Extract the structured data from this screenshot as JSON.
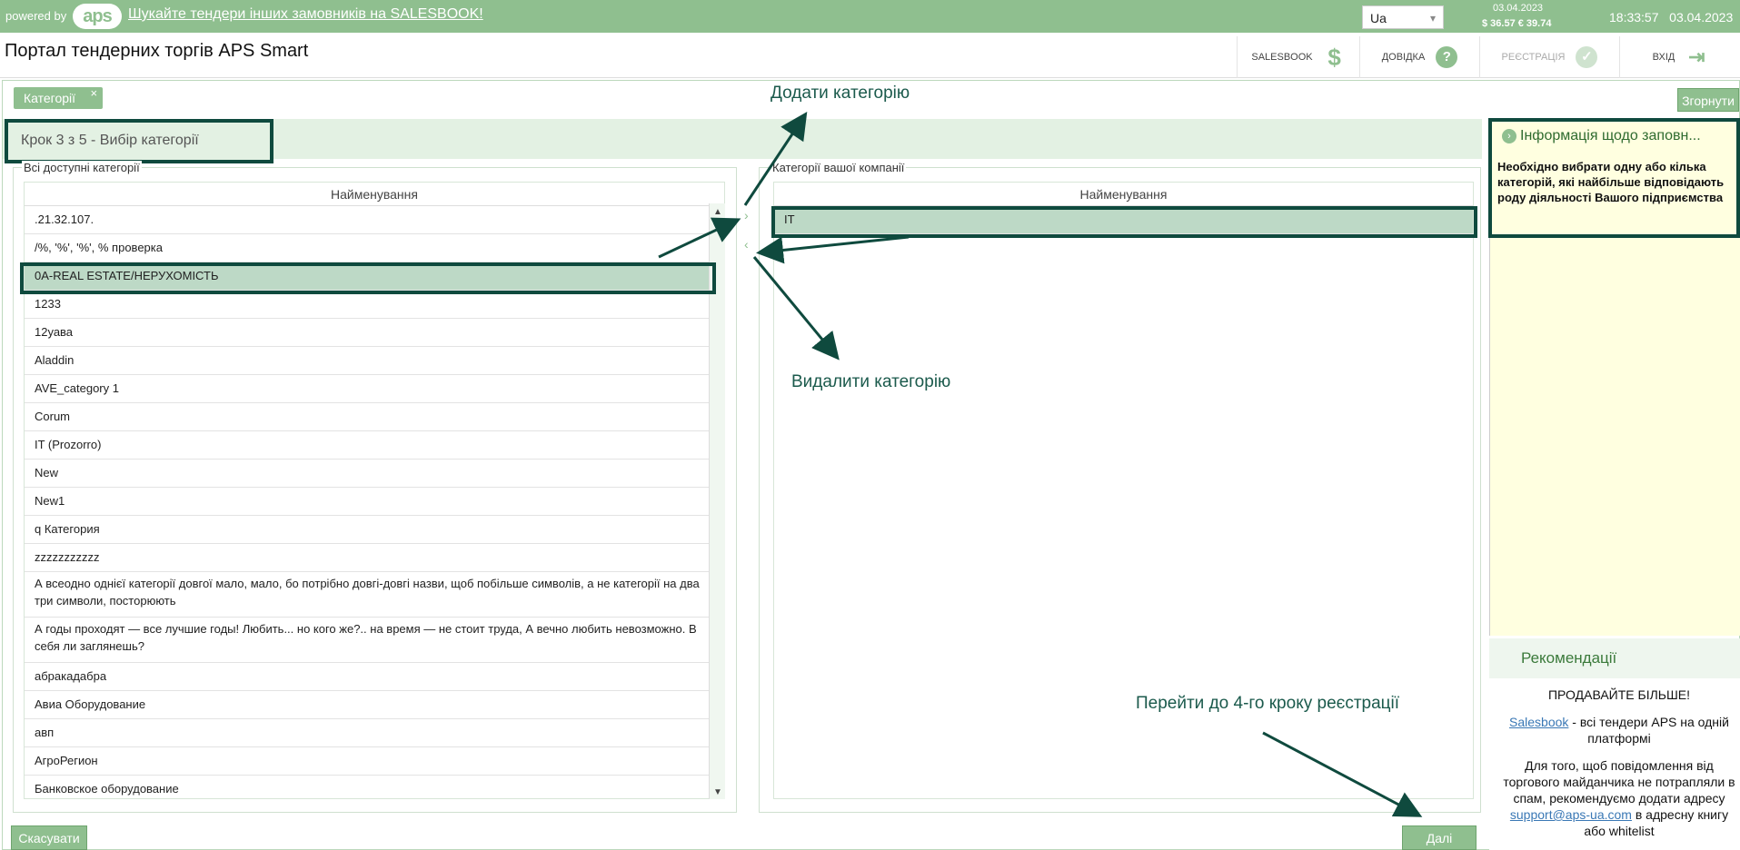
{
  "topbar": {
    "powered_by": "powered by",
    "logo_text": "aps",
    "promo_link": "Шукайте тендери інших замовників на SALESBOOK!",
    "language": "Ua",
    "rates_date": "03.04.2023",
    "rates": "$ 36.57  € 39.74",
    "time": "18:33:57",
    "date": "03.04.2023"
  },
  "header": {
    "title": "Портал тендерних торгів APS Smart",
    "nav": {
      "salesbook": "SALESBOOK",
      "help": "ДОВІДКА",
      "registration": "РЕЄСТРАЦІЯ",
      "login": "ВХІД"
    }
  },
  "tabs": {
    "categories": "Категорії",
    "close": "×",
    "collapse": "Згорнути"
  },
  "step": {
    "title": "Крок 3 з 5 - Вибір категорії"
  },
  "available": {
    "legend": "Всі доступні категорії",
    "column": "Найменування",
    "rows": [
      ".21.32.107.",
      "/%, '%', '%', % проверка",
      "0A-REAL ESTATE/НЕРУХОМІСТЬ",
      "1233",
      "12уава",
      "Aladdin",
      "AVE_category 1",
      "Corum",
      "IT (Prozorro)",
      "New",
      "New1",
      "q Категория",
      "zzzzzzzzzzz",
      "А всеодно однієї категорії довгої мало, мало, бо потрібно довгі-довгі назви, щоб побільше символів, а не категорії на два три символи, посторюють",
      "А годы проходят — все лучшие годы! Любить... но кого же?.. на время — не стоит труда, А вечно любить невозможно. В себя ли заглянешь?",
      "абракадабра",
      "Авиа Оборудование",
      "авп",
      "АгроРегион",
      "Банковское оборудование"
    ],
    "selected_index": 2
  },
  "company": {
    "legend": "Категорії вашої компанії",
    "column": "Найменування",
    "rows": [
      "IT"
    ]
  },
  "annotations": {
    "add": "Додати категорію",
    "remove": "Видалити категорію",
    "next_step": "Перейти до 4-го кроку реєстрації"
  },
  "info": {
    "title": "Інформація щодо заповн...",
    "text": "Необхідно вибрати одну або кілька категорій, які найбільше відповідають роду діяльності Вашого підприємства"
  },
  "recommendations": {
    "title": "Рекомендації",
    "sell_more": "ПРОДАВАЙТЕ БІЛЬШЕ!",
    "salesbook_link": "Salesbook",
    "salesbook_text": " - всі тендери APS на одній платформі",
    "spam_text_1": "Для того, щоб повідомлення від торгового майданчика не потрапляли в спам, рекомендуємо додати адресу ",
    "email": "support@aps-ua.com",
    "spam_text_2": " в адресну книгу або whitelist"
  },
  "buttons": {
    "cancel": "Скасувати",
    "next": "Далі"
  },
  "colors": {
    "brand_green": "#8fbf8f",
    "annotation_dark": "#0f4a3e",
    "info_bg": "#ffffe0"
  }
}
